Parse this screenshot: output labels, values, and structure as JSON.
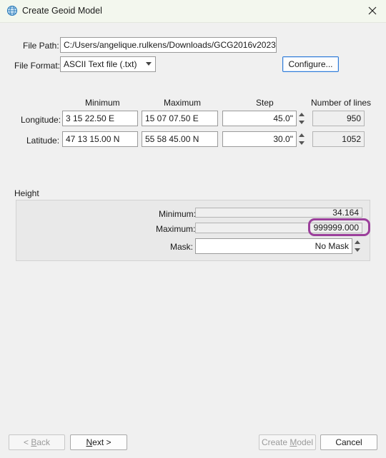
{
  "window": {
    "title": "Create Geoid Model"
  },
  "file": {
    "path_label": "File Path:",
    "path_value": "C:/Users/angelique.rulkens/Downloads/GCG2016v2023.txt",
    "format_label": "File Format:",
    "format_value": "ASCII Text file (.txt)",
    "configure_label": "Configure..."
  },
  "grid": {
    "headers": {
      "minimum": "Minimum",
      "maximum": "Maximum",
      "step": "Step",
      "lines": "Number of lines"
    },
    "longitude": {
      "label": "Longitude:",
      "min": "3 15 22.50 E",
      "max": "15 07 07.50 E",
      "step": "45.0\"",
      "lines": "950"
    },
    "latitude": {
      "label": "Latitude:",
      "min": "47 13 15.00 N",
      "max": "55 58 45.00 N",
      "step": "30.0\"",
      "lines": "1052"
    }
  },
  "height": {
    "group_label": "Height",
    "minimum_label": "Minimum:",
    "minimum_value": "34.164",
    "maximum_label": "Maximum:",
    "maximum_value": "999999.000",
    "mask_label": "Mask:",
    "mask_value": "No Mask",
    "highlight_color": "#9b3f9b"
  },
  "buttons": {
    "back_pre": "< ",
    "back_ul": "B",
    "back_post": "ack",
    "next_ul": "N",
    "next_post": "ext >",
    "create_pre": "Create ",
    "create_ul": "M",
    "create_post": "odel",
    "cancel": "Cancel"
  },
  "colors": {
    "accent": "#2f7bd6",
    "titlebar": "#f3f7ee"
  }
}
